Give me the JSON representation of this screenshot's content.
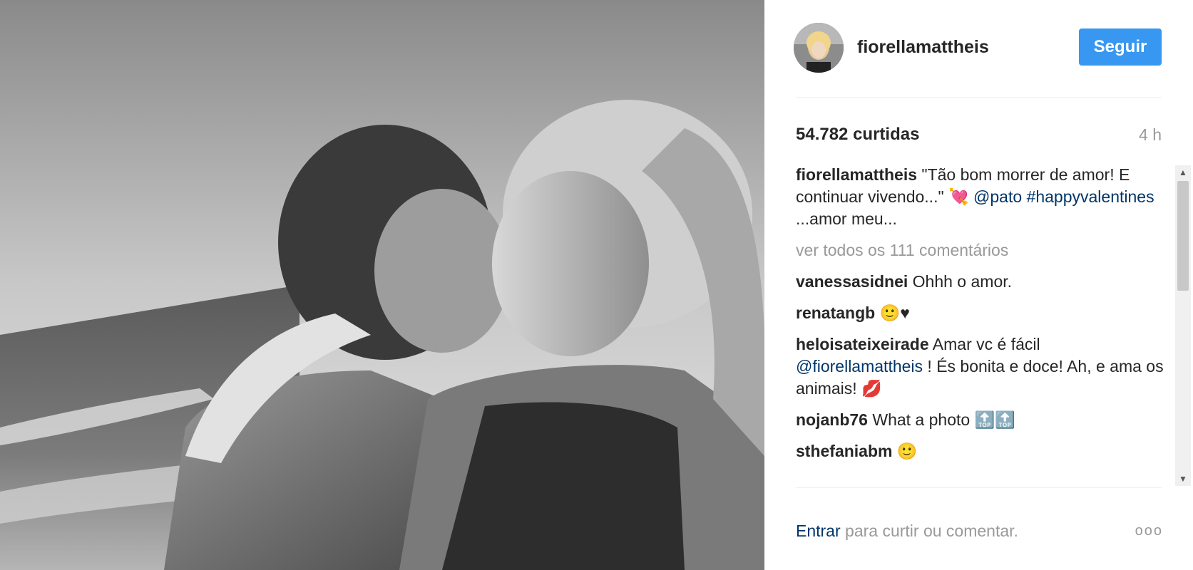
{
  "post": {
    "username": "fiorellamattheis",
    "follow_label": "Seguir",
    "likes": "54.782 curtidas",
    "time": "4 h"
  },
  "caption": {
    "username": "fiorellamattheis",
    "text": "\"Tão bom morrer de amor! E continuar vivendo...\"",
    "emoji": "💘",
    "mention": "@pato",
    "hashtag": "#happyvalentines",
    "tail": "...amor meu..."
  },
  "view_all": "ver todos os 111 comentários",
  "comments": [
    {
      "username": "vanessasidnei",
      "text": "Ohhh o amor."
    },
    {
      "username": "renatangb",
      "text": "🙂♥"
    },
    {
      "username": "heloisateixeirade",
      "pre": "Amar vc é fácil",
      "mention": "@fiorellamattheis",
      "text": "! És bonita e doce! Ah, e ama os animais! 💋"
    },
    {
      "username": "nojanb76",
      "text": "What a photo 🔝🔝"
    },
    {
      "username": "sthefaniabm",
      "text": "🙂"
    }
  ],
  "footer": {
    "login_link": "Entrar",
    "login_text": "para curtir ou comentar.",
    "more": "ooo"
  },
  "scrollbar": {
    "visible_fraction": 0.38
  },
  "colors": {
    "button": "#3897f0",
    "link": "#003569",
    "muted": "#999999",
    "text": "#262626"
  },
  "icons": {
    "avatar": "avatar-image",
    "more": "more-options-icon"
  }
}
